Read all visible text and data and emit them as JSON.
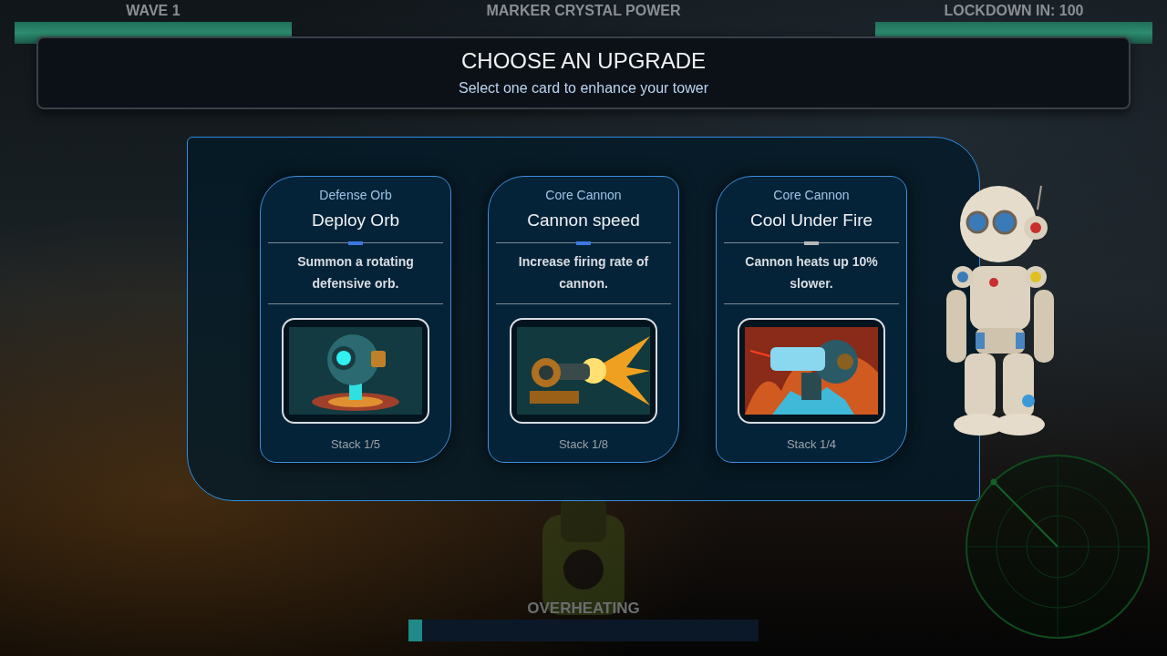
{
  "hud": {
    "wave": {
      "label": "WAVE 1",
      "level": 1
    },
    "crystal": {
      "label": "MARKER CRYSTAL POWER"
    },
    "lockdown": {
      "label": "LOCKDOWN IN: 100",
      "level": 1
    }
  },
  "header": {
    "title": "CHOOSE AN UPGRADE",
    "subtitle": "Select one card to enhance your tower"
  },
  "cards": [
    {
      "kind": "orb",
      "category": "Defense Orb",
      "title": "Deploy Orb",
      "color": "#3d78e0",
      "description": "Summon a rotating defensive orb.",
      "stack": "Stack 1/5"
    },
    {
      "kind": "cannon",
      "category": "Core Cannon",
      "title": "Cannon speed",
      "color": "#3d78e0",
      "description": "Increase firing rate of cannon.",
      "stack": "Stack 1/8"
    },
    {
      "kind": "frost-cannon",
      "category": "Core Cannon",
      "title": "Cool Under Fire",
      "color": "#b8b8b8",
      "description": "Cannon heats up 10% slower.",
      "stack": "Stack 1/4"
    }
  ],
  "overheating": {
    "label": "OVERHEATING",
    "level": 0.04
  }
}
